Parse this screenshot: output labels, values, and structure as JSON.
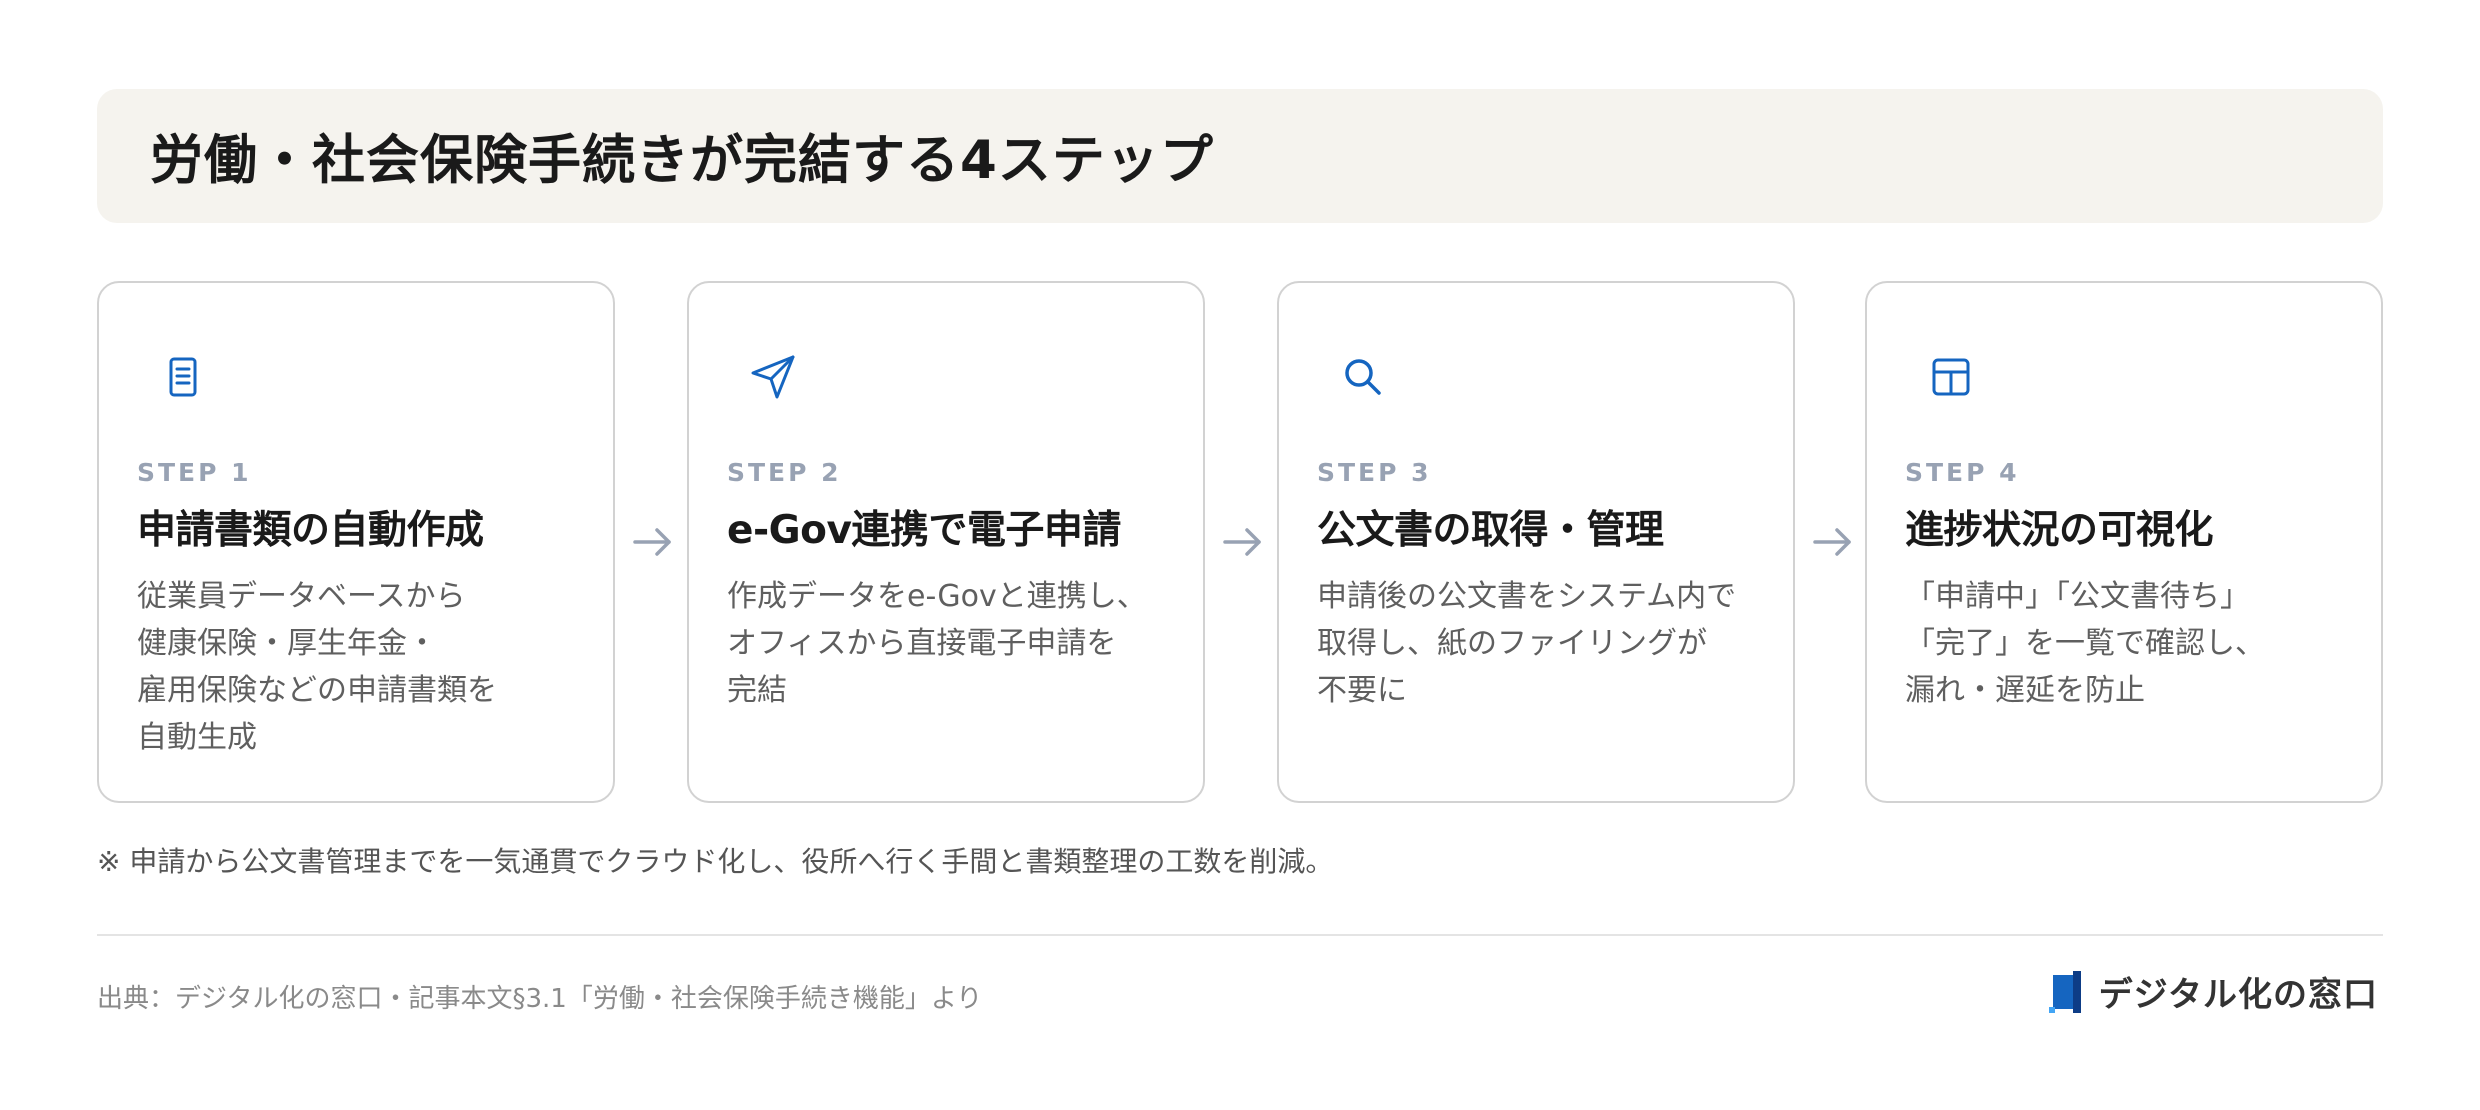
{
  "header": {
    "title": "労働・社会保険手続きが完結する4ステップ"
  },
  "steps": [
    {
      "icon": "document-icon",
      "label": "STEP 1",
      "title": "申請書類の自動作成",
      "desc": [
        "従業員データベースから",
        "健康保険・厚生年金・",
        "雇用保険などの申請書類を",
        "自動生成"
      ]
    },
    {
      "icon": "send-icon",
      "label": "STEP 2",
      "title": "e-Gov連携で電子申請",
      "desc": [
        "作成データをe-Govと連携し、",
        "オフィスから直接電子申請を",
        "完結"
      ]
    },
    {
      "icon": "search-icon",
      "label": "STEP 3",
      "title": "公文書の取得・管理",
      "desc": [
        "申請後の公文書をシステム内で",
        "取得し、紙のファイリングが",
        "不要に"
      ]
    },
    {
      "icon": "grid-table-icon",
      "label": "STEP 4",
      "title": "進捗状況の可視化",
      "desc": [
        "「申請中」「公文書待ち」",
        "「完了」を一覧で確認し、",
        "漏れ・遅延を防止"
      ]
    }
  ],
  "note": "※ 申請から公文書管理までを一気通貫でクラウド化し、役所へ行く手間と書類整理の工数を削減。",
  "footer": {
    "source": "出典：デジタル化の窓口・記事本文§3.1「労働・社会保険手続き機能」より",
    "brand": "デジタル化の窓口"
  },
  "colors": {
    "accent": "#1565c0",
    "muted": "#98a2b3",
    "panel": "#f5f3ee"
  }
}
